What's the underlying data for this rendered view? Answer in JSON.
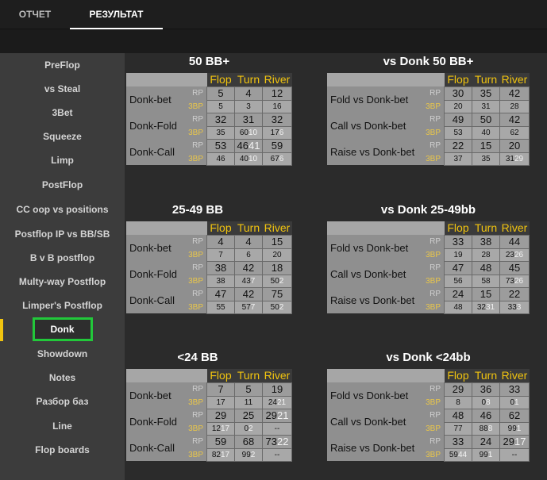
{
  "tabs": [
    {
      "label": "ОТЧЕТ",
      "active": false
    },
    {
      "label": "РЕЗУЛЬТАТ",
      "active": true
    }
  ],
  "sidebar": {
    "items": [
      {
        "label": "PreFlop"
      },
      {
        "label": "vs Steal"
      },
      {
        "label": "3Bet"
      },
      {
        "label": "Squeeze"
      },
      {
        "label": "Limp"
      },
      {
        "label": "PostFlop"
      },
      {
        "label": "CC oop vs positions"
      },
      {
        "label": "Postflop IP vs BB/SB"
      },
      {
        "label": "B v B postflop"
      },
      {
        "label": "Multy-way Postflop"
      },
      {
        "label": "Limper's Postflop"
      },
      {
        "label": "Donk",
        "active": true
      },
      {
        "label": "Showdown"
      },
      {
        "label": "Notes"
      },
      {
        "label": "Разбор баз"
      },
      {
        "label": "Line"
      },
      {
        "label": "Flop boards"
      }
    ],
    "active_color": "#22c83a"
  },
  "columns": [
    "Flop",
    "Turn",
    "River"
  ],
  "tags": {
    "rp": "RP",
    "tb": "3BP"
  },
  "sections": [
    {
      "title": "50 BB+",
      "rows": [
        {
          "label": "Donk-bet",
          "rp": [
            [
              "5",
              ""
            ],
            [
              "4",
              ""
            ],
            [
              "12",
              ""
            ]
          ],
          "tb": [
            [
              "5",
              ""
            ],
            [
              "3",
              ""
            ],
            [
              "16",
              ""
            ]
          ]
        },
        {
          "label": "Donk-Fold",
          "rp": [
            [
              "32",
              ""
            ],
            [
              "31",
              ""
            ],
            [
              "32",
              ""
            ]
          ],
          "tb": [
            [
              "35",
              ""
            ],
            [
              "60",
              "10"
            ],
            [
              "17",
              "6"
            ]
          ]
        },
        {
          "label": "Donk-Call",
          "rp": [
            [
              "53",
              ""
            ],
            [
              "46",
              "41"
            ],
            [
              "59",
              ""
            ]
          ],
          "tb": [
            [
              "46",
              ""
            ],
            [
              "40",
              "10"
            ],
            [
              "67",
              "6"
            ]
          ]
        }
      ]
    },
    {
      "title": "vs Donk 50 BB+",
      "rows": [
        {
          "label": "Fold vs Donk-bet",
          "rp": [
            [
              "30",
              ""
            ],
            [
              "35",
              ""
            ],
            [
              "42",
              ""
            ]
          ],
          "tb": [
            [
              "20",
              ""
            ],
            [
              "31",
              ""
            ],
            [
              "28",
              ""
            ]
          ]
        },
        {
          "label": "Call vs Donk-bet",
          "rp": [
            [
              "49",
              ""
            ],
            [
              "50",
              ""
            ],
            [
              "42",
              ""
            ]
          ],
          "tb": [
            [
              "53",
              ""
            ],
            [
              "40",
              ""
            ],
            [
              "62",
              ""
            ]
          ]
        },
        {
          "label": "Raise vs Donk-bet",
          "rp": [
            [
              "22",
              ""
            ],
            [
              "15",
              ""
            ],
            [
              "20",
              ""
            ]
          ],
          "tb": [
            [
              "37",
              ""
            ],
            [
              "35",
              ""
            ],
            [
              "31",
              "29"
            ]
          ]
        }
      ]
    },
    {
      "title": "25-49 BB",
      "rows": [
        {
          "label": "Donk-bet",
          "rp": [
            [
              "4",
              ""
            ],
            [
              "4",
              ""
            ],
            [
              "15",
              ""
            ]
          ],
          "tb": [
            [
              "7",
              ""
            ],
            [
              "6",
              ""
            ],
            [
              "20",
              ""
            ]
          ]
        },
        {
          "label": "Donk-Fold",
          "rp": [
            [
              "38",
              ""
            ],
            [
              "42",
              ""
            ],
            [
              "18",
              ""
            ]
          ],
          "tb": [
            [
              "38",
              ""
            ],
            [
              "43",
              "7"
            ],
            [
              "50",
              "2"
            ]
          ]
        },
        {
          "label": "Donk-Call",
          "rp": [
            [
              "47",
              ""
            ],
            [
              "42",
              ""
            ],
            [
              "75",
              ""
            ]
          ],
          "tb": [
            [
              "55",
              ""
            ],
            [
              "57",
              "7"
            ],
            [
              "50",
              "2"
            ]
          ]
        }
      ]
    },
    {
      "title": "vs Donk 25-49bb",
      "rows": [
        {
          "label": "Fold vs Donk-bet",
          "rp": [
            [
              "33",
              ""
            ],
            [
              "38",
              ""
            ],
            [
              "44",
              ""
            ]
          ],
          "tb": [
            [
              "19",
              ""
            ],
            [
              "28",
              ""
            ],
            [
              "23",
              "26"
            ]
          ]
        },
        {
          "label": "Call vs Donk-bet",
          "rp": [
            [
              "47",
              ""
            ],
            [
              "48",
              ""
            ],
            [
              "45",
              ""
            ]
          ],
          "tb": [
            [
              "56",
              ""
            ],
            [
              "58",
              ""
            ],
            [
              "73",
              "26"
            ]
          ]
        },
        {
          "label": "Raise vs Donk-bet",
          "rp": [
            [
              "24",
              ""
            ],
            [
              "15",
              ""
            ],
            [
              "22",
              ""
            ]
          ],
          "tb": [
            [
              "48",
              ""
            ],
            [
              "32",
              "31"
            ],
            [
              "33",
              "3"
            ]
          ]
        }
      ]
    },
    {
      "title": "<24 BB",
      "rows": [
        {
          "label": "Donk-bet",
          "rp": [
            [
              "7",
              ""
            ],
            [
              "5",
              ""
            ],
            [
              "19",
              ""
            ]
          ],
          "tb": [
            [
              "17",
              ""
            ],
            [
              "11",
              ""
            ],
            [
              "24",
              "21"
            ]
          ]
        },
        {
          "label": "Donk-Fold",
          "rp": [
            [
              "29",
              ""
            ],
            [
              "25",
              ""
            ],
            [
              "29",
              "21"
            ]
          ],
          "tb": [
            [
              "12",
              "17"
            ],
            [
              "0",
              "2"
            ],
            [
              "--",
              ""
            ]
          ]
        },
        {
          "label": "Donk-Call",
          "rp": [
            [
              "59",
              ""
            ],
            [
              "68",
              ""
            ],
            [
              "73",
              "22"
            ]
          ],
          "tb": [
            [
              "82",
              "17"
            ],
            [
              "99",
              "2"
            ],
            [
              "--",
              ""
            ]
          ]
        }
      ]
    },
    {
      "title": "vs Donk <24bb",
      "rows": [
        {
          "label": "Fold vs Donk-bet",
          "rp": [
            [
              "29",
              ""
            ],
            [
              "36",
              ""
            ],
            [
              "33",
              ""
            ]
          ],
          "tb": [
            [
              "8",
              ""
            ],
            [
              "0",
              "8"
            ],
            [
              "0",
              "1"
            ]
          ]
        },
        {
          "label": "Call vs Donk-bet",
          "rp": [
            [
              "48",
              ""
            ],
            [
              "46",
              ""
            ],
            [
              "62",
              ""
            ]
          ],
          "tb": [
            [
              "77",
              ""
            ],
            [
              "88",
              "8"
            ],
            [
              "99",
              "1"
            ]
          ]
        },
        {
          "label": "Raise vs Donk-bet",
          "rp": [
            [
              "33",
              ""
            ],
            [
              "24",
              ""
            ],
            [
              "29",
              "17"
            ]
          ],
          "tb": [
            [
              "59",
              "44"
            ],
            [
              "99",
              "1"
            ],
            [
              "--",
              ""
            ]
          ]
        }
      ]
    }
  ]
}
